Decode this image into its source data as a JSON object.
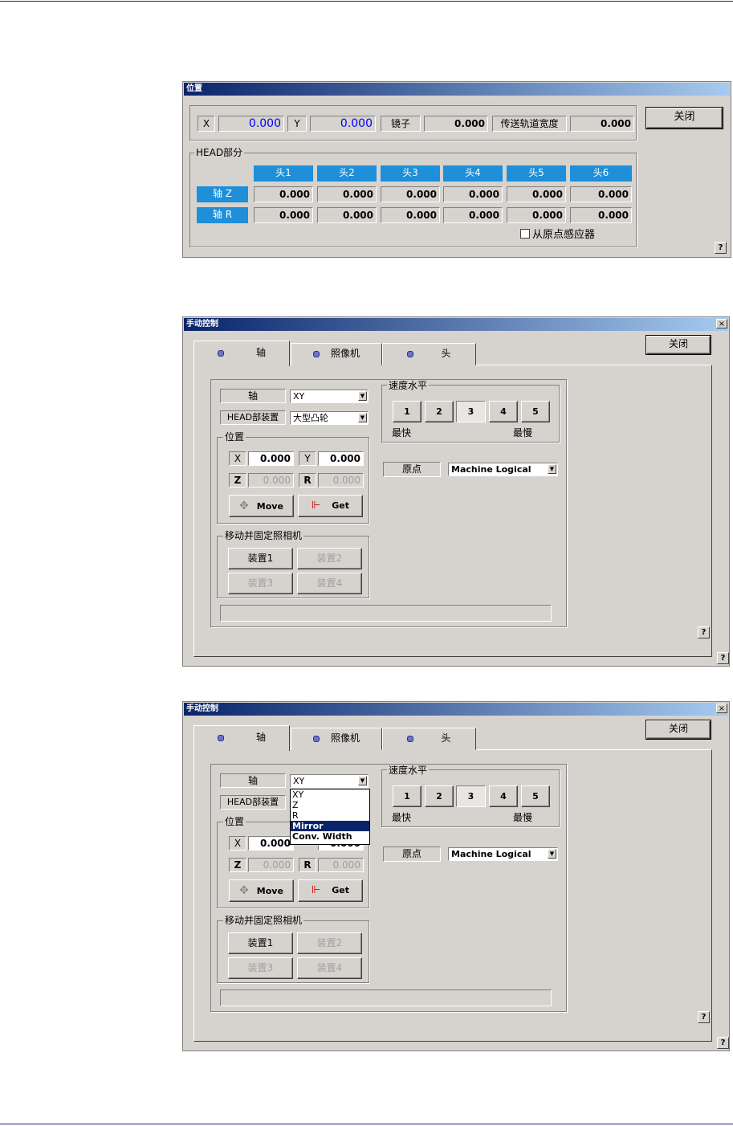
{
  "position_window": {
    "title": "位置",
    "x_label": "X",
    "x_value": "0.000",
    "y_label": "Y",
    "y_value": "0.000",
    "mirror_label": "镜子",
    "mirror_value": "0.000",
    "conv_label": "传送轨道宽度",
    "conv_value": "0.000",
    "close_label": "关闭",
    "head_group_label": "HEAD部分",
    "heads": [
      "头1",
      "头2",
      "头3",
      "头4",
      "头5",
      "头6"
    ],
    "axis_z_label": "轴 Z",
    "axis_r_label": "轴 R",
    "z_values": [
      "0.000",
      "0.000",
      "0.000",
      "0.000",
      "0.000",
      "0.000"
    ],
    "r_values": [
      "0.000",
      "0.000",
      "0.000",
      "0.000",
      "0.000",
      "0.000"
    ],
    "origin_sensor_label": "从原点感应器",
    "help": "?",
    "value_color": "#0000ff",
    "head_color": "#1e8fd8"
  },
  "manual_windows": [
    {
      "title": "手动控制",
      "close_x": "×",
      "tabs": [
        "轴",
        "照像机",
        "头"
      ],
      "close_label": "关闭",
      "axis_label": "轴",
      "axis_value": "XY",
      "head_device_label": "HEAD部装置",
      "head_device_value": "大型凸轮",
      "position_group": "位置",
      "x_label": "X",
      "x_value": "0.000",
      "y_label": "Y",
      "y_value": "0.000",
      "z_label": "Z",
      "z_value": "0.000",
      "r_label": "R",
      "r_value": "0.000",
      "move_label": "Move",
      "get_label": "Get",
      "camera_group": "移动并固定照相机",
      "device_buttons": [
        "装置1",
        "装置2",
        "装置3",
        "装置4"
      ],
      "speed_group": "速度水平",
      "speeds": [
        "1",
        "2",
        "3",
        "4",
        "5"
      ],
      "fastest": "最快",
      "slowest": "最慢",
      "origin_label": "原点",
      "origin_value": "Machine Logical",
      "help": "?"
    },
    {
      "title": "手动控制",
      "close_x": "×",
      "tabs": [
        "轴",
        "照像机",
        "头"
      ],
      "close_label": "关闭",
      "axis_label": "轴",
      "axis_value": "XY",
      "head_device_label": "HEAD部装置",
      "position_group": "位置",
      "x_label": "X",
      "x_value": "0.000",
      "y_value_partial": "0.000",
      "z_label": "Z",
      "z_value": "0.000",
      "r_label": "R",
      "r_value": "0.000",
      "move_label": "Move",
      "get_label": "Get",
      "camera_group": "移动并固定照相机",
      "device_buttons": [
        "装置1",
        "装置2",
        "装置3",
        "装置4"
      ],
      "speed_group": "速度水平",
      "speeds": [
        "1",
        "2",
        "3",
        "4",
        "5"
      ],
      "fastest": "最快",
      "slowest": "最慢",
      "origin_label": "原点",
      "origin_value": "Machine Logical",
      "help": "?",
      "dropdown_options": [
        "XY",
        "Z",
        "R",
        "Mirror",
        "Conv. Width"
      ],
      "dropdown_selected": "Mirror"
    }
  ]
}
